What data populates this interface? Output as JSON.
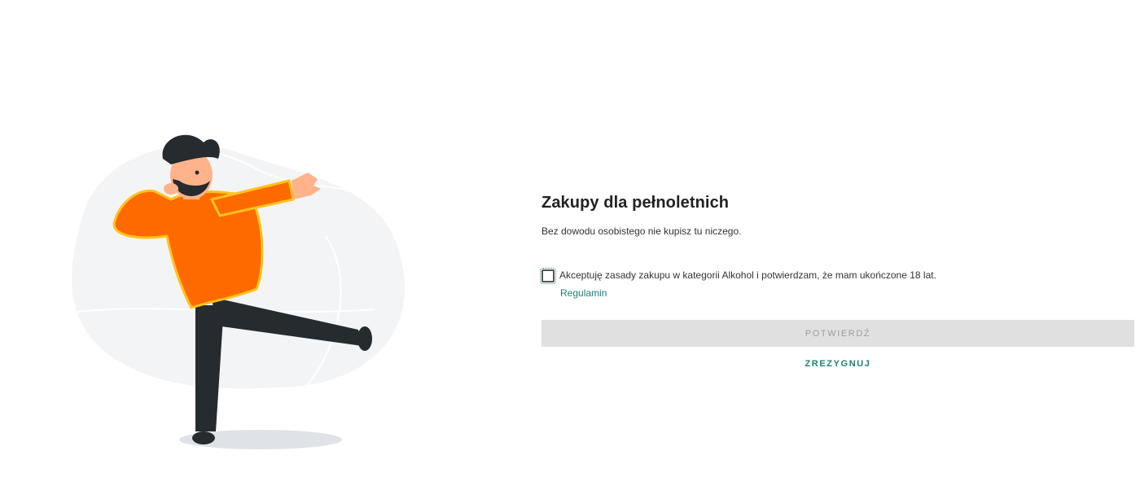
{
  "dialog": {
    "title": "Zakupy dla pełnoletnich",
    "subtitle": "Bez dowodu osobistego nie kupisz tu niczego.",
    "consent_text": "Akceptuję zasady zakupu w kategorii Alkohol i potwierdzam, że mam ukończone 18 lat.",
    "consent_checked": false,
    "rules_link": "Regulamin",
    "confirm_label": "POTWIERDŹ",
    "confirm_enabled": false,
    "cancel_label": "ZREZYGNUJ"
  },
  "colors": {
    "accent": "#1f7f73",
    "sweater": "#ff6a00",
    "sweater_outline": "#ffc21a",
    "pants": "#252b2e",
    "skin": "#ffb38a",
    "background_blob": "#f3f4f6",
    "disabled_button": "#e0e0e0"
  },
  "illustration": {
    "icon": "man-dancing-illustration"
  }
}
